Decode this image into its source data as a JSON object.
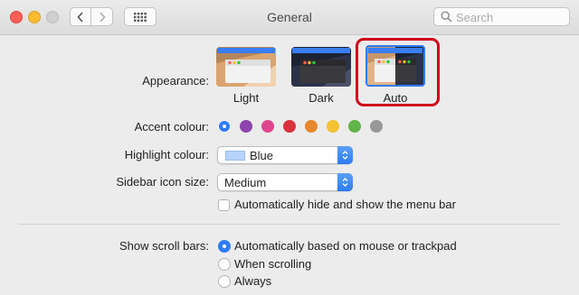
{
  "window": {
    "title": "General"
  },
  "search": {
    "placeholder": "Search"
  },
  "appearance": {
    "label": "Appearance:",
    "options": [
      {
        "label": "Light",
        "theme": "light"
      },
      {
        "label": "Dark",
        "theme": "dark"
      },
      {
        "label": "Auto",
        "theme": "auto",
        "selected": true
      }
    ]
  },
  "accent": {
    "label": "Accent colour:",
    "colors": [
      "#2f7cf6",
      "#8e44ad",
      "#e0468f",
      "#d9323c",
      "#e8862c",
      "#f3c233",
      "#5fb547",
      "#989898"
    ],
    "selected_index": 0
  },
  "highlight": {
    "label": "Highlight colour:",
    "value": "Blue",
    "chip_color": "#b5d3fe"
  },
  "sidebar_icon": {
    "label": "Sidebar icon size:",
    "value": "Medium"
  },
  "menubar": {
    "label": "Automatically hide and show the menu bar",
    "checked": false
  },
  "scrollbars": {
    "label": "Show scroll bars:",
    "options": [
      "Automatically based on mouse or trackpad",
      "When scrolling",
      "Always"
    ],
    "selected_index": 0
  },
  "colors": {
    "highlight_frame": "#d0021b",
    "accent_blue": "#2f7cf6"
  }
}
